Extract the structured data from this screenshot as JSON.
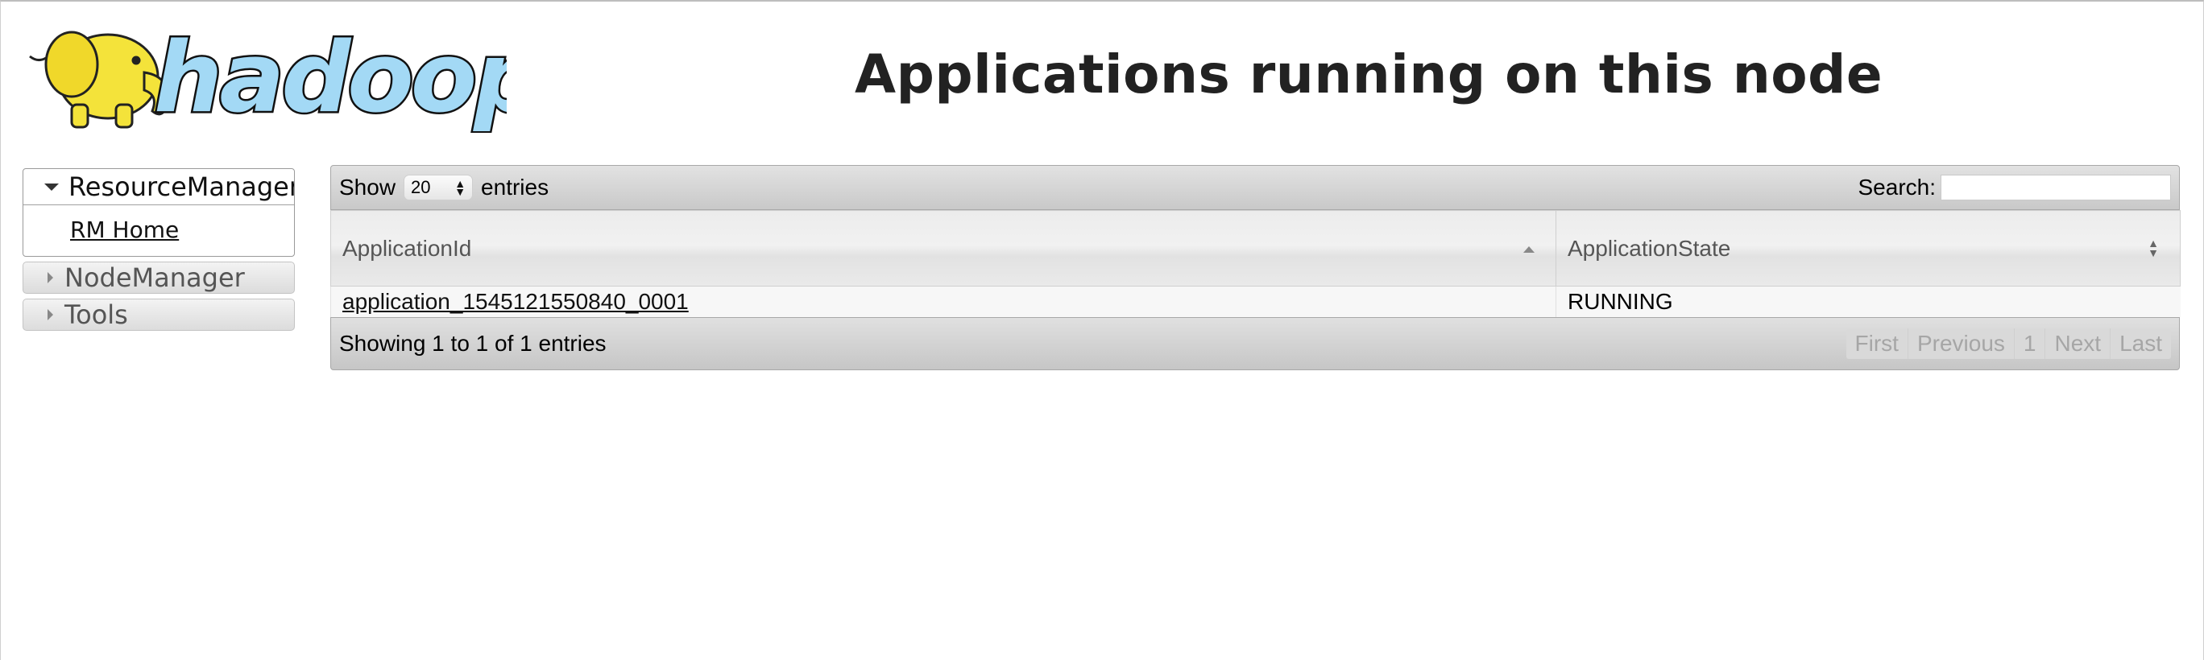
{
  "header": {
    "logo_text": "hadoop",
    "title": "Applications running on this node"
  },
  "sidebar": {
    "groups": [
      {
        "label": "ResourceManager",
        "expanded": true,
        "items": [
          {
            "label": "RM Home"
          }
        ]
      },
      {
        "label": "NodeManager",
        "expanded": false
      },
      {
        "label": "Tools",
        "expanded": false
      }
    ]
  },
  "table": {
    "show_label": "Show",
    "entries_label": "entries",
    "page_size": "20",
    "search_label": "Search:",
    "search_value": "",
    "columns": [
      {
        "label": "ApplicationId",
        "sort": "ascending"
      },
      {
        "label": "ApplicationState",
        "sort": "none"
      }
    ],
    "rows": [
      {
        "application_id": "application_1545121550840_0001",
        "state": "RUNNING"
      }
    ],
    "info": "Showing 1 to 1 of 1 entries",
    "pagination": {
      "first": "First",
      "previous": "Previous",
      "page": "1",
      "next": "Next",
      "last": "Last"
    }
  },
  "colors": {
    "logo_yellow": "#f4e33a",
    "logo_blue": "#a3d9f5",
    "title": "#222222"
  }
}
